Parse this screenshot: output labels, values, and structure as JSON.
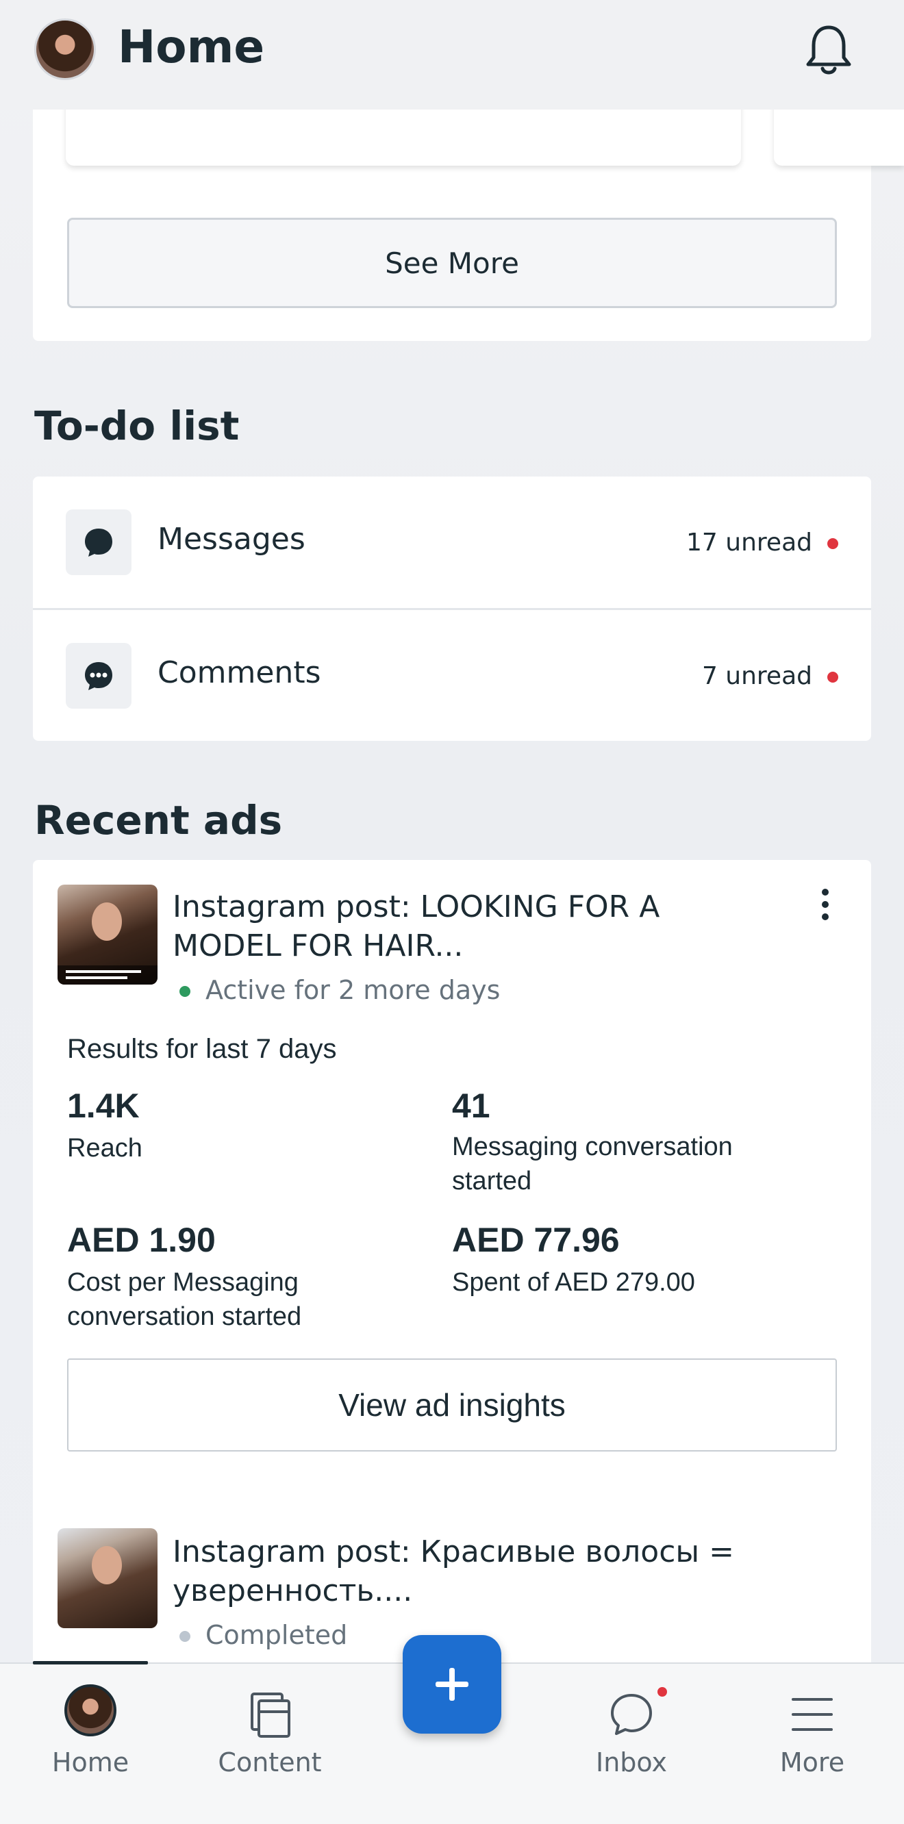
{
  "header": {
    "title": "Home"
  },
  "top_card": {
    "see_more_label": "See More"
  },
  "todo": {
    "title": "To-do list",
    "items": [
      {
        "label": "Messages",
        "count": "17 unread"
      },
      {
        "label": "Comments",
        "count": "7 unread"
      }
    ]
  },
  "recent_ads": {
    "title": "Recent ads",
    "ads": [
      {
        "title": "Instagram post: LOOKING FOR A MODEL FOR HAIR...",
        "status": "Active for 2 more days",
        "status_color": "#2e9a5f",
        "results_label": "Results for last 7 days",
        "metrics": [
          {
            "value": "1.4K",
            "label": "Reach"
          },
          {
            "value": "41",
            "label": "Messaging conversation started"
          },
          {
            "value": "AED 1.90",
            "label": "Cost per Messaging conversation started"
          },
          {
            "value": "AED 77.96",
            "label": "Spent of AED 279.00"
          }
        ],
        "insights_label": "View ad insights"
      },
      {
        "title": "Instagram post: Красивые волосы = уверенность....",
        "status": "Completed",
        "status_color": "#bcc5cf"
      }
    ]
  },
  "bottom_nav": {
    "items": [
      {
        "label": "Home"
      },
      {
        "label": "Content"
      },
      {
        "label": "Inbox"
      },
      {
        "label": "More"
      }
    ],
    "fab_icon": "plus-icon"
  },
  "colors": {
    "accent": "#1d6ed0",
    "unread_dot": "#e0353f"
  }
}
